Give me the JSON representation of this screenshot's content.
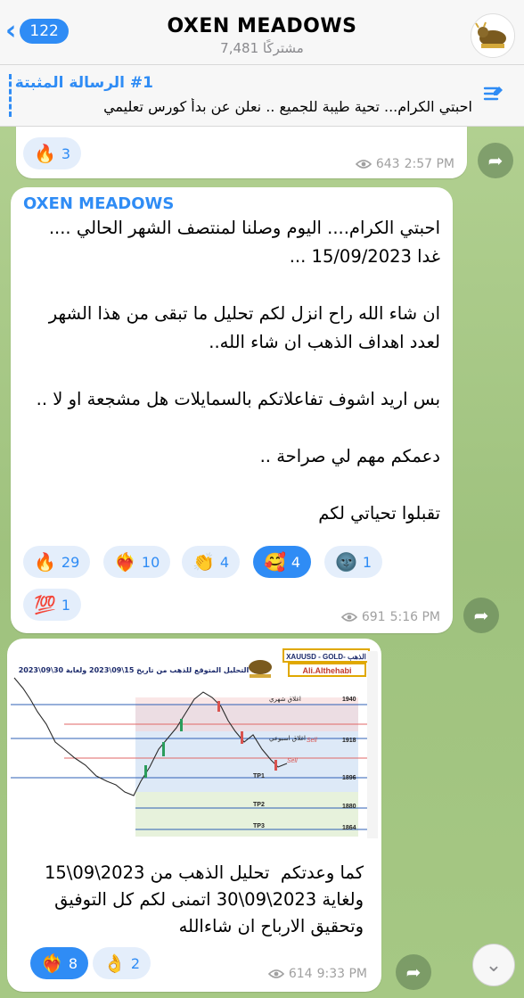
{
  "header": {
    "back_count": "122",
    "title": "OXEN MEADOWS",
    "subtitle": "7,481 مشتركًا"
  },
  "pinned": {
    "title": "#1 الرسالة المثبتة",
    "text": "احبتي الكرام... تحية طيبة للجميع .. نعلن عن بدأ كورس تعليمي"
  },
  "msg1": {
    "reaction": {
      "emoji": "🔥",
      "count": "3"
    },
    "views": "643",
    "time": "2:57 PM"
  },
  "msg2": {
    "sender": "OXEN MEADOWS",
    "text": "احبتي الكرام.... اليوم وصلنا لمنتصف الشهر الحالي .... غدا 15/09/2023 ...\n\nان شاء الله راح انزل لكم تحليل ما تبقى من هذا الشهر لعدد اهداف الذهب ان شاء الله..\n\nبس اريد اشوف تفاعلاتكم بالسمايلات هل مشجعة او لا ..\n\nدعمكم مهم لي صراحة ..\n\nتقبلوا تحياتي لكم",
    "reactions": [
      {
        "emoji": "🔥",
        "count": "29"
      },
      {
        "emoji": "❤️‍🔥",
        "count": "10"
      },
      {
        "emoji": "👏",
        "count": "4"
      },
      {
        "emoji": "🥰",
        "count": "4"
      },
      {
        "emoji": "🌚",
        "count": "1"
      },
      {
        "emoji": "💯",
        "count": "1"
      }
    ],
    "views": "691",
    "time": "5:16 PM"
  },
  "msg3": {
    "chart": {
      "header_title": "التحليل المتوقع للذهب من تاريخ 15\\09\\2023 ولغاية 30\\09\\2023",
      "badge": "XAUUSD - GOLD- الذهب",
      "author": "Ali.Althehabi",
      "levels": [
        {
          "label": "اغلاق شهري",
          "value": "1940"
        },
        {
          "label": "اغلاق اسبوعي",
          "value": "1918"
        },
        {
          "label": "TP1",
          "value": "1896"
        },
        {
          "label": "TP2",
          "value": "1880"
        },
        {
          "label": "TP3",
          "value": "1864"
        }
      ],
      "sell1": "Sell",
      "sell2": "Sell"
    },
    "text": "كما وعدتكم  تحليل الذهب من 2023\\09\\15 ولغاية 2023\\09\\30 اتمنى لكم كل التوفيق وتحقيق الارباح ان شاءالله",
    "reactions": [
      {
        "emoji": "❤️‍🔥",
        "count": "8"
      },
      {
        "emoji": "👌",
        "count": "2"
      }
    ],
    "views": "614",
    "time": "9:33 PM"
  },
  "colors": {
    "accent": "#2f8cf5",
    "chat_bg": "#a9c98a",
    "bubble": "#ffffff"
  },
  "icons": [
    "chevron-left-icon",
    "pin-list-icon",
    "eye-icon",
    "forward-icon",
    "chevron-down-icon"
  ]
}
